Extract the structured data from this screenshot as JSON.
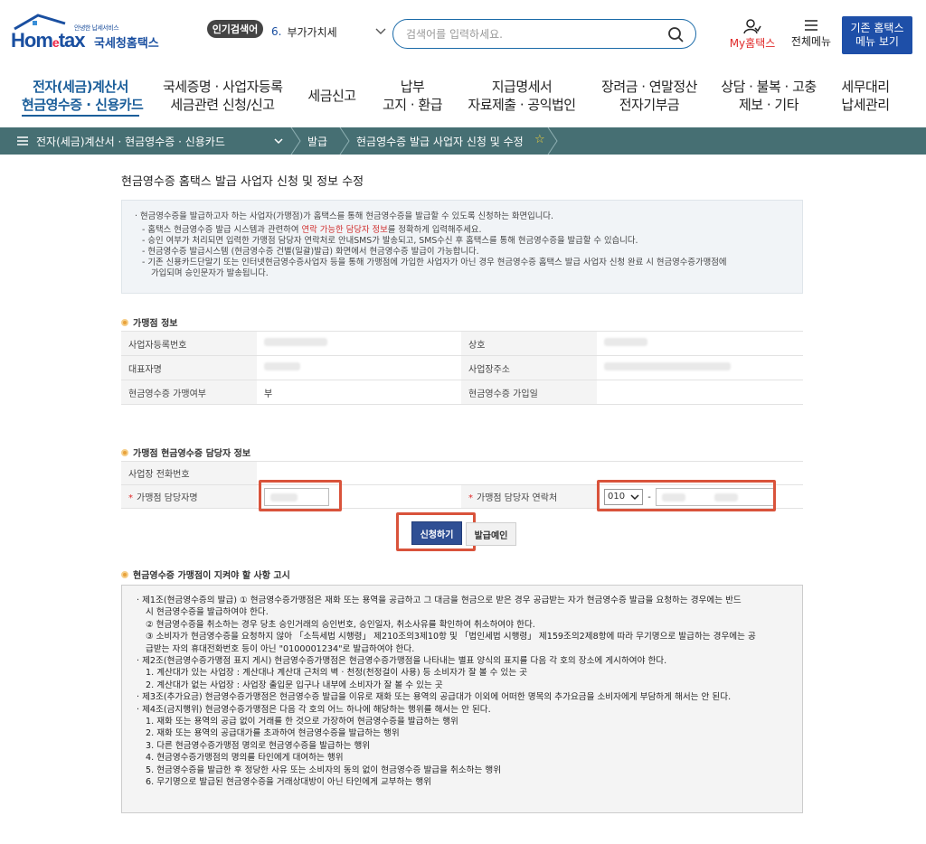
{
  "header": {
    "logo_sub": "안녕한 납세서비스",
    "logo_main_a": "Hom",
    "logo_main_e": "e",
    "logo_main_b": "tax",
    "logo_kr": "국세청홈택스",
    "popular_label": "인기검색어",
    "popular_num": "6.",
    "popular_value": "부가가치세",
    "search_placeholder": "검색어를 입력하세요.",
    "my_hometax": "My홈택스",
    "all_menu": "전체메뉴",
    "old_btn_l1": "기존 홈택스",
    "old_btn_l2": "메뉴 보기"
  },
  "nav": [
    {
      "l1": "전자(세금)계산서",
      "l2": "현금영수증 · 신용카드"
    },
    {
      "l1": "국세증명 · 사업자등록",
      "l2": "세금관련 신청/신고"
    },
    {
      "l1": "세금신고",
      "l2": ""
    },
    {
      "l1": "납부",
      "l2": "고지 · 환급"
    },
    {
      "l1": "지급명세서",
      "l2": "자료제출 · 공익법인"
    },
    {
      "l1": "장려금 · 연말정산",
      "l2": "전자기부금"
    },
    {
      "l1": "상담 · 불복 · 고충",
      "l2": "제보 · 기타"
    },
    {
      "l1": "세무대리",
      "l2": "납세관리"
    }
  ],
  "breadcrumb": {
    "c1": "전자(세금)계산서 · 현금영수증 · 신용카드",
    "c2": "발급",
    "c3": "현금영수증 발급 사업자 신청 및 수정"
  },
  "page_title": "현금영수증 홈택스 발급 사업자 신청 및 정보 수정",
  "notice": {
    "intro": "· 현금영수증을 발급하고자 하는 사업자(가맹점)가 홈택스를 통해 현금영수증을 발급할 수 있도록 신청하는 화면입니다.",
    "l1a": "- 홈택스 현금영수증 발급 시스템과 관련하여 ",
    "l1r": "연락 가능한 담당자 정보",
    "l1b": "를 정확하게 입력해주세요.",
    "l2": "- 승인 여부가 처리되면 입력한 가맹점 담당자 연락처로 안내SMS가 발송되고, SMS수신 후 홈택스를 통해 현금영수증을 발급할 수 있습니다.",
    "l3": "- 현금영수증 발급시스템 (현금영수증 건별(일괄)발급) 화면에서 현금영수증 발급이 가능합니다.",
    "l4": "- 기존 신용카드단말기 또는 인터넷현금영수증사업자 등을 통해 가맹점에 가입한 사업자가 아닌 경우 현금영수증 홈택스 발급 사업자 신청 완료 시 현금영수증가맹점에",
    "l4b": "가입되며 승인문자가 발송됩니다."
  },
  "merchant_info": {
    "title": "가맹점 정보",
    "biz_no_label": "사업자등록번호",
    "name_label": "상호",
    "ceo_label": "대표자명",
    "addr_label": "사업장주소",
    "joined_label": "현금영수증 가맹여부",
    "joined_value": "부",
    "join_date_label": "현금영수증 가입일"
  },
  "contact_info": {
    "title": "가맹점 현금영수증 담당자 정보",
    "phone_label": "사업장 전화번호",
    "manager_label": "가맹점 담당자명",
    "contact_label": "가맹점 담당자 연락처",
    "prefix_value": "010",
    "dash": "-"
  },
  "buttons": {
    "apply": "신청하기",
    "confirm": "발급예인"
  },
  "rules": {
    "title": "현금영수증 가맹점이 지켜야 할 사항 고시",
    "lines": [
      "· 제1조(현금영수증의 발급) ① 현금영수증가맹점은 재화 또는 용역을 공급하고 그 대금을 현금으로 받은 경우 공급받는 자가 현금영수증 발급을 요청하는 경우에는 반드",
      "  시 현금영수증을 발급하여야 한다.",
      "  ② 현금영수증을 취소하는 경우 당초 승인거래의 승인번호, 승인일자, 취소사유를 확인하여 취소하여야 한다.",
      "  ③ 소비자가 현금영수증을 요청하지 않아 「소득세법 시행령」 제210조의3제10항 및 「법인세법 시행령」 제159조의2제8항에 따라 무기명으로 발급하는 경우에는 공",
      "  급받는 자의 휴대전화번호 등이 아닌 \"0100001234\"로 발급하여야 한다.",
      "· 제2조(현금영수증가맹점 표지 게시) 현금영수증가맹점은 현금영수증가맹점을 나타내는 별표 양식의 표지를 다음 각 호의 장소에 게시하여야 한다.",
      "  1. 계산대가 있는 사업장 : 계산대나 계산대 근처의 벽 · 천정(천정걸이 사용) 등 소비자가 잘 볼 수 있는 곳",
      "  2. 계산대가 없는 사업장 : 사업장 출입문 입구나 내부에 소비자가 잘 볼 수 있는 곳",
      "· 제3조(추가요금) 현금영수증가맹점은 현금영수증 발급을 이유로 재화 또는 용역의 공급대가 이외에 어떠한 명목의 추가요금을 소비자에게 부담하게 해서는 안 된다.",
      "· 제4조(금지행위) 현금영수증가맹점은 다음 각 호의 어느 하나에 해당하는 행위를 해서는 안 된다.",
      "  1. 재화 또는 용역의 공급 없이 거래를 한 것으로 가장하여 현금영수증을 발급하는 행위",
      "  2. 재화 또는 용역의 공급대가를 초과하여 현금영수증을 발급하는 행위",
      "  3. 다른 현금영수증가맹점 명의로 현금영수증을 발급하는 행위",
      "  4. 현금영수증가맹점의 명의를 타인에게 대여하는 행위",
      "  5. 현금영수증을 발급한 후 정당한 사유 또는 소비자의 동의 없이 현금영수증 발급을 취소하는 행위",
      "  6. 무기명으로 발급된 현금영수증을 거래상대방이 아닌 타인에게 교부하는 행위"
    ]
  },
  "colors": {
    "brand_blue": "#1a4fa0",
    "crumb_bg": "#466f73",
    "highlight_red": "#d9533b"
  }
}
